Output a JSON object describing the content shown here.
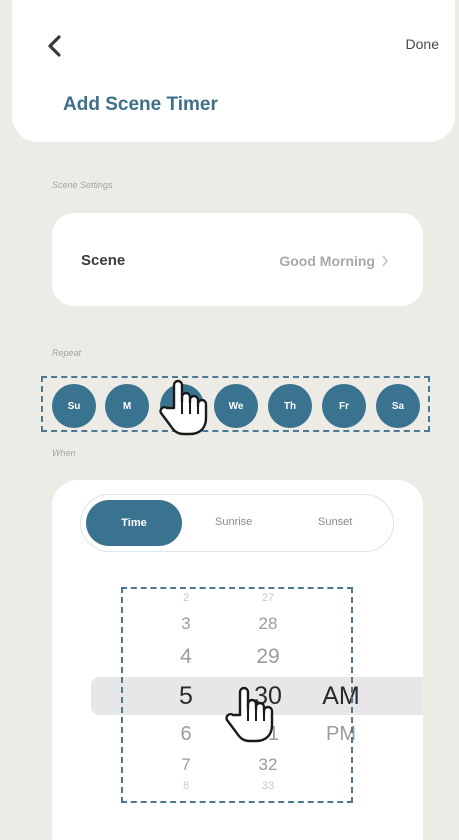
{
  "header": {
    "back_icon": "chevron-left-icon",
    "done_label": "Done",
    "title": "Add Scene Timer"
  },
  "scene_settings": {
    "section_label": "Scene Settings",
    "scene_label": "Scene",
    "scene_value": "Good Morning",
    "chevron_icon": "chevron-right-icon"
  },
  "repeat": {
    "section_label": "Repeat",
    "days": [
      "Su",
      "M",
      "Tu",
      "We",
      "Th",
      "Fr",
      "Sa"
    ]
  },
  "when": {
    "section_label": "When",
    "tabs": [
      "Time",
      "Sunrise",
      "Sunset"
    ],
    "selected_tab": "Time",
    "hour_column": [
      "2",
      "3",
      "4",
      "5",
      "6",
      "7",
      "8"
    ],
    "minute_column": [
      "27",
      "28",
      "29",
      "30",
      "31",
      "32",
      "33"
    ],
    "period_column": [
      "AM",
      "PM"
    ],
    "selected": {
      "hour": "5",
      "minute": "30",
      "period": "AM"
    }
  },
  "colors": {
    "accent": "#3a7390",
    "title": "#3f6f89",
    "background": "#ecebe6",
    "dashed_outline": "#4d7894"
  },
  "overlays": {
    "pointer_icon": "hand-pointer-icon"
  }
}
